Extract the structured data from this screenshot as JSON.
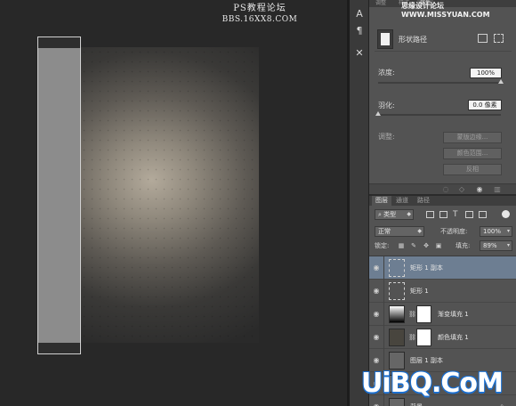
{
  "watermark": {
    "line1": "PS教程论坛",
    "line2": "BBS.16XX8.COM"
  },
  "strip": {
    "icons": [
      "type-icon",
      "paragraph-icon",
      "tools-icon"
    ]
  },
  "properties": {
    "tabs": [
      "调整",
      "样式",
      "属性"
    ],
    "site_overlay": "思缘设计论坛  WWW.MISSYUAN.COM",
    "title": "形状路径",
    "density_label": "浓度:",
    "density_value": "100%",
    "density_level": 1.0,
    "feather_label": "羽化:",
    "feather_value": "0.0 像素",
    "feather_level": 0.0,
    "adjust_label": "调整:",
    "buttons": [
      "蒙版边缘...",
      "颜色范围...",
      "反相"
    ]
  },
  "layers": {
    "tabs": [
      "图层",
      "通道",
      "路径"
    ],
    "filter_type": "类型",
    "blend_mode": "正常",
    "opacity_label": "不透明度:",
    "opacity_value": "100%",
    "lock_label": "锁定:",
    "fill_label": "填充:",
    "fill_value": "89%",
    "items": [
      {
        "name": "矩形 1 副本",
        "thumb": "shape",
        "mask": false,
        "selected": true
      },
      {
        "name": "矩形 1",
        "thumb": "shape",
        "mask": false,
        "selected": false
      },
      {
        "name": "渐变填充 1",
        "thumb": "grad",
        "mask": true,
        "selected": false
      },
      {
        "name": "颜色填充 1",
        "thumb": "solid",
        "mask": true,
        "selected": false
      },
      {
        "name": "图层 1 副本",
        "thumb": "gray",
        "mask": false,
        "selected": false
      },
      {
        "name": "",
        "thumb": "gray",
        "mask": false,
        "selected": false
      },
      {
        "name": "背景",
        "thumb": "gray",
        "mask": false,
        "selected": false
      }
    ]
  },
  "logo": {
    "text": "UiBQ.CoM"
  },
  "colors": {
    "selection": "#6d7e92",
    "panel": "#535353",
    "logo_outline": "#1b6fd0"
  }
}
